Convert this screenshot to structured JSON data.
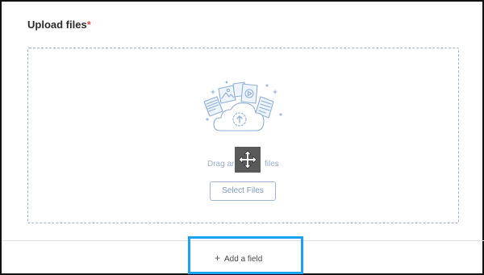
{
  "form": {
    "upload_label": "Upload files",
    "required_marker": "*"
  },
  "dropzone": {
    "drag_text_left": "Drag ar",
    "drag_text_right": "files",
    "select_button_label": "Select Files"
  },
  "footer": {
    "add_field_label": "Add a field"
  },
  "icons": {
    "illustration": "cloud-upload-with-files-icon",
    "cursor": "move-cursor-icon",
    "add": "plus-icon"
  },
  "colors": {
    "accent_blue": "#1da1f2",
    "dropzone_border": "#9ab3d3",
    "required": "#d9534f"
  }
}
